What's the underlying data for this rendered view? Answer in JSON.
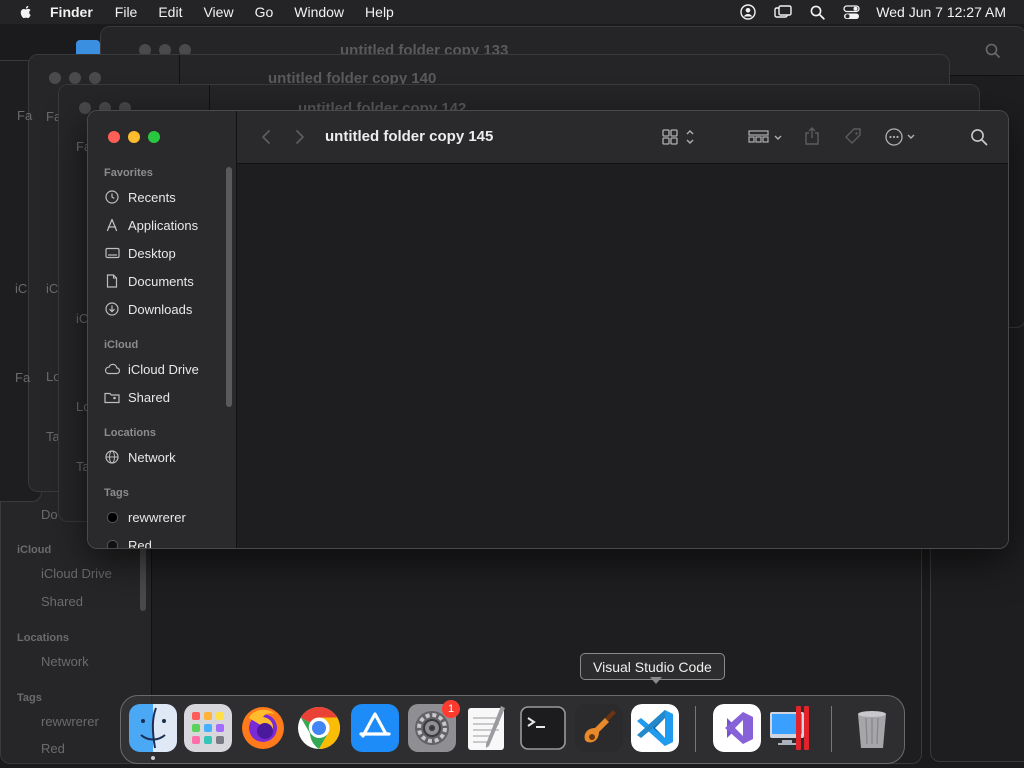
{
  "menubar": {
    "app_name": "Finder",
    "menus": [
      "File",
      "Edit",
      "View",
      "Go",
      "Window",
      "Help"
    ],
    "clock": "Wed Jun 7  12:27 AM",
    "status_icons": [
      "user-icon",
      "screen-mirror-icon",
      "spotlight-search-icon",
      "control-center-icon"
    ]
  },
  "background_windows": {
    "titles": [
      "untitled folder copy 133",
      "untitled folder copy 140",
      "untitled folder copy 142"
    ],
    "sidebar_fragments": [
      "Fa",
      "Fa",
      "Fa",
      "iC",
      "iC",
      "iC",
      "Lo",
      "Lo",
      "Ta",
      "Ta",
      "Fa"
    ],
    "back_sidebar": {
      "documents": "Do",
      "icloud_head": "iCloud",
      "icloud_drive": "iCloud Drive",
      "shared": "Shared",
      "locations_head": "Locations",
      "network": "Network",
      "tags_head": "Tags",
      "tag1": "rewwrerer",
      "tag2": "Red"
    }
  },
  "window": {
    "title": "untitled folder copy 145",
    "sidebar": {
      "favorites_head": "Favorites",
      "favorites": [
        {
          "label": "Recents",
          "icon": "clock-icon"
        },
        {
          "label": "Applications",
          "icon": "applications-icon"
        },
        {
          "label": "Desktop",
          "icon": "desktop-icon"
        },
        {
          "label": "Documents",
          "icon": "document-icon"
        },
        {
          "label": "Downloads",
          "icon": "download-icon"
        }
      ],
      "icloud_head": "iCloud",
      "icloud": [
        {
          "label": "iCloud Drive",
          "icon": "cloud-icon"
        },
        {
          "label": "Shared",
          "icon": "shared-folder-icon"
        }
      ],
      "locations_head": "Locations",
      "locations": [
        {
          "label": "Network",
          "icon": "globe-icon"
        }
      ],
      "tags_head": "Tags",
      "tags": [
        {
          "label": "rewwrerer",
          "color": "#000000"
        },
        {
          "label": "Red",
          "color": "#ff3b30"
        }
      ]
    },
    "toolbar_icons": [
      "back-icon",
      "forward-icon",
      "icon-view-icon",
      "group-icon",
      "share-icon",
      "tag-icon",
      "more-icon",
      "search-icon"
    ]
  },
  "dock": {
    "tooltip": "Visual Studio Code",
    "badge": "1",
    "apps": [
      "finder-icon",
      "launchpad-icon",
      "firefox-icon",
      "chrome-icon",
      "app-store-icon",
      "system-settings-icon",
      "textedit-icon",
      "terminal-icon",
      "garageband-icon",
      "vscode-icon",
      "visual-studio-icon",
      "parallels-icon",
      "trash-icon"
    ]
  },
  "colors": {
    "close": "#ff5f57",
    "minimize": "#febc2e",
    "maximize": "#28c840",
    "badge": "#ff3b30"
  }
}
